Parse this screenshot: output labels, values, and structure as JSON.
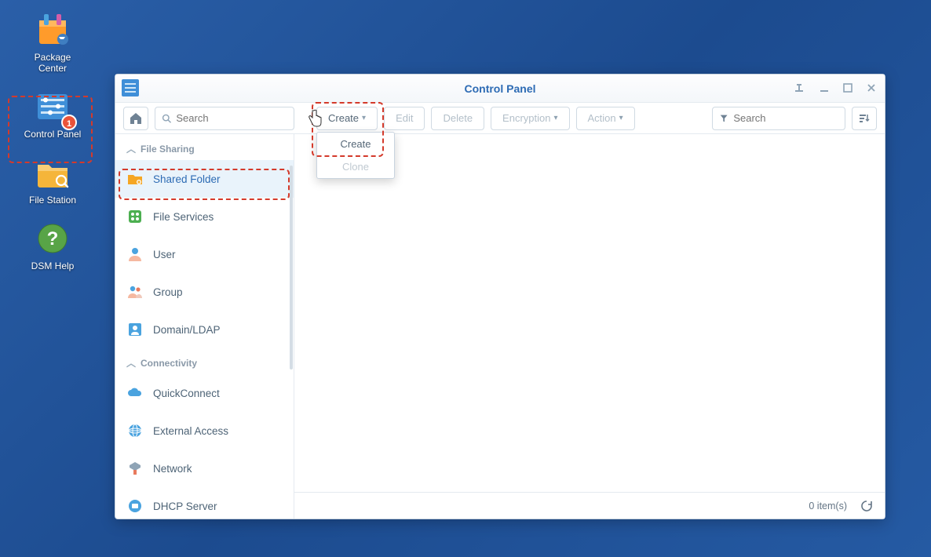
{
  "desktop": {
    "items": [
      {
        "label": "Package\nCenter"
      },
      {
        "label": "Control Panel",
        "badge": "1"
      },
      {
        "label": "File Station"
      },
      {
        "label": "DSM Help"
      }
    ]
  },
  "window": {
    "title": "Control Panel",
    "sidebar_search_placeholder": "Search",
    "toolbar": {
      "create": "Create",
      "edit": "Edit",
      "delete": "Delete",
      "encryption": "Encryption",
      "action": "Action",
      "search_placeholder": "Search"
    },
    "create_menu": {
      "create": "Create",
      "clone": "Clone"
    },
    "sidebar": {
      "sections": [
        {
          "title": "File Sharing",
          "items": [
            {
              "label": "Shared Folder",
              "active": true
            },
            {
              "label": "File Services"
            },
            {
              "label": "User"
            },
            {
              "label": "Group"
            },
            {
              "label": "Domain/LDAP"
            }
          ]
        },
        {
          "title": "Connectivity",
          "items": [
            {
              "label": "QuickConnect"
            },
            {
              "label": "External Access"
            },
            {
              "label": "Network"
            },
            {
              "label": "DHCP Server"
            }
          ]
        }
      ]
    },
    "status": "0 item(s)"
  },
  "colors": {
    "accent": "#2d6bb4"
  }
}
